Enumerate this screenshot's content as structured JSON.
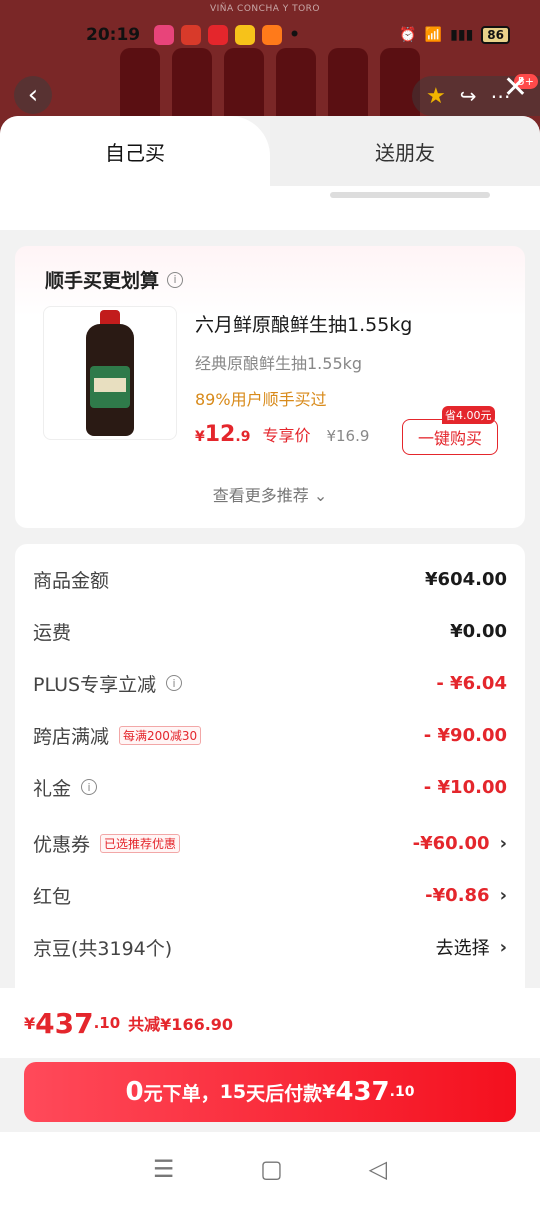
{
  "status": {
    "time": "20:19",
    "battery": "86",
    "app_icon_colors": [
      "#e8447a",
      "#d83a2a",
      "#e4262c",
      "#f6c21a",
      "#ff7a1a"
    ]
  },
  "background": {
    "brand": "VIÑA CONCHA Y TORO",
    "cart_badge": "5+"
  },
  "tabs": [
    {
      "label": "自己买",
      "active": true
    },
    {
      "label": "送朋友",
      "active": false
    }
  ],
  "recommend": {
    "title": "顺手买更划算",
    "product": {
      "name": "六月鲜原酿鲜生抽1.55kg",
      "subtitle": "经典原酿鲜生抽1.55kg",
      "rate": "89%用户顺手买过",
      "price_yen": "¥",
      "price_int": "12",
      "price_dec": ".9",
      "price_tag": "专享价",
      "orig_price": "¥16.9",
      "save_badge": "省4.00元",
      "buy_label": "一键购买"
    },
    "more": "查看更多推荐"
  },
  "fees": [
    {
      "label": "商品金额",
      "value": "¥604.00",
      "red": false,
      "chevron": false
    },
    {
      "label": "运费",
      "value": "¥0.00",
      "red": false,
      "chevron": false
    },
    {
      "label": "PLUS专享立减",
      "value": "- ¥6.04",
      "red": true,
      "chevron": false,
      "info": true
    },
    {
      "label": "跨店满减",
      "value": "- ¥90.00",
      "red": true,
      "chevron": false,
      "tag": "每满200减30"
    },
    {
      "label": "礼金",
      "value": "- ¥10.00",
      "red": true,
      "chevron": false,
      "info": true
    },
    {
      "label": "优惠券",
      "value": "-¥60.00",
      "red": true,
      "chevron": true,
      "tag": "已选推荐优惠"
    },
    {
      "label": "红包",
      "value": "-¥0.86",
      "red": true,
      "chevron": true
    },
    {
      "label": "京豆(共3194个)",
      "value": "去选择",
      "red": false,
      "chevron": true,
      "plain": true
    }
  ],
  "total": {
    "yen": "¥",
    "int": "437",
    "dec": ".10",
    "saved": "共减¥166.90"
  },
  "submit": {
    "zero": "0",
    "text1": "元下单，",
    "days": "15",
    "text2": "天后付款",
    "yen": "¥",
    "int": "437",
    "dec": ".10"
  }
}
